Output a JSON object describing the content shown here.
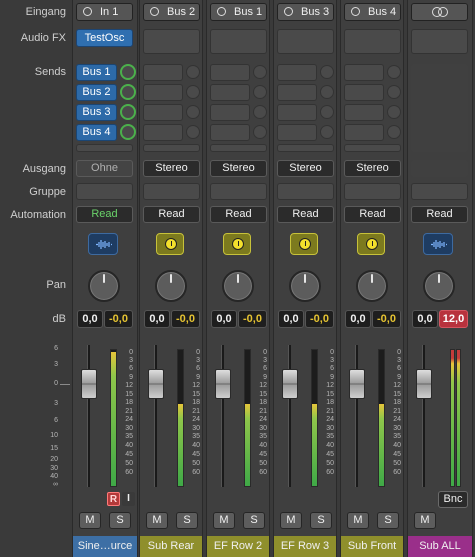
{
  "row_labels": {
    "eingang": "Eingang",
    "audio_fx": "Audio FX",
    "sends": "Sends",
    "ausgang": "Ausgang",
    "gruppe": "Gruppe",
    "automation": "Automation",
    "pan": "Pan",
    "db": "dB"
  },
  "scale_marks": [
    "6",
    "3",
    "0",
    "3",
    "6",
    "10",
    "15",
    "20",
    "30",
    "40",
    "∞"
  ],
  "meter_marks": [
    "0",
    "3",
    "6",
    "9",
    "12",
    "15",
    "18",
    "21",
    "24",
    "30",
    "35",
    "40",
    "45",
    "50",
    "60"
  ],
  "strips": [
    {
      "name": "Sine…urce",
      "name_color": "#3d6fa5",
      "input": "In 1",
      "audio_fx": "TestOsc",
      "sends": [
        "Bus 1",
        "Bus 2",
        "Bus 3",
        "Bus 4"
      ],
      "output": "Ohne",
      "automation": "Read",
      "db_left": "0,0",
      "db_right": "-0,0",
      "record_label": "R",
      "input_label": "I",
      "mute": "M",
      "solo": "S"
    },
    {
      "name": "Sub Rear",
      "name_color": "#8f8f2c",
      "input": "Bus 2",
      "output": "Stereo",
      "automation": "Read",
      "db_left": "0,0",
      "db_right": "-0,0",
      "mute": "M",
      "solo": "S"
    },
    {
      "name": "EF Row 2",
      "name_color": "#8f8f2c",
      "input": "Bus 1",
      "output": "Stereo",
      "automation": "Read",
      "db_left": "0,0",
      "db_right": "-0,0",
      "mute": "M",
      "solo": "S"
    },
    {
      "name": "EF Row 3",
      "name_color": "#8f8f2c",
      "input": "Bus 3",
      "output": "Stereo",
      "automation": "Read",
      "db_left": "0,0",
      "db_right": "-0,0",
      "mute": "M",
      "solo": "S"
    },
    {
      "name": "Sub Front",
      "name_color": "#8f8f2c",
      "input": "Bus 4",
      "output": "Stereo",
      "automation": "Read",
      "db_left": "0,0",
      "db_right": "-0,0",
      "mute": "M",
      "solo": "S"
    },
    {
      "name": "Sub ALL",
      "name_color": "#9a2f8a",
      "automation": "Read",
      "db_left": "0,0",
      "db_right": "12,0",
      "bounce": "Bnc",
      "mute": "M"
    }
  ]
}
